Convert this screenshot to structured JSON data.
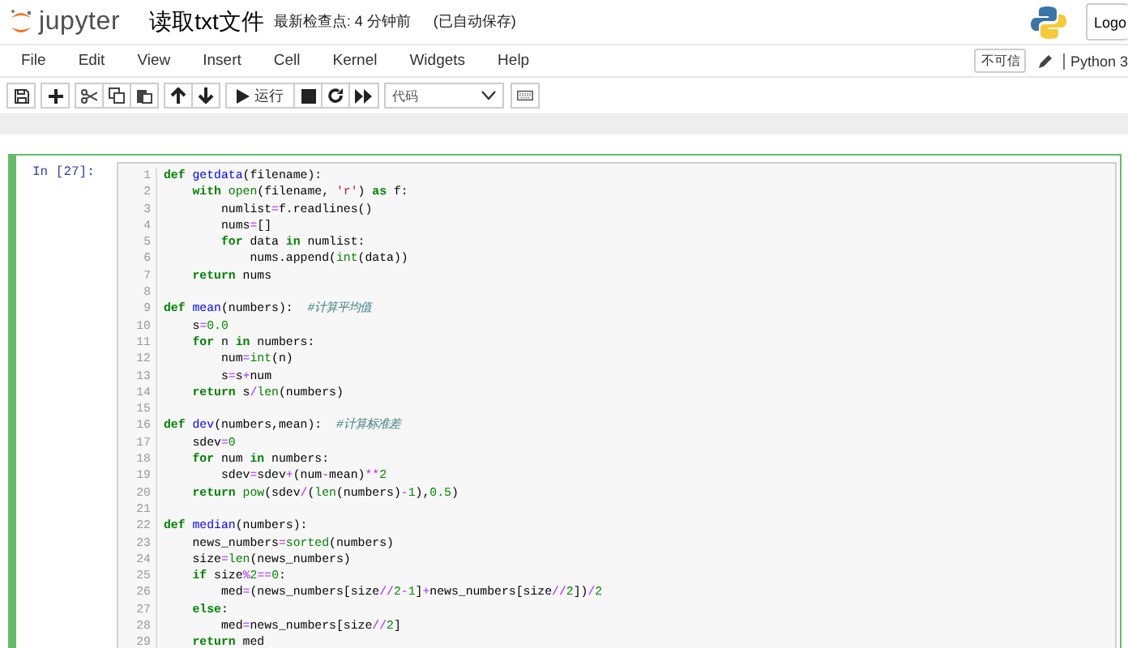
{
  "header": {
    "logo_text": "jupyter",
    "notebook_title": "读取txt文件",
    "checkpoint": "最新检查点: 4 分钟前",
    "autosave": "(已自动保存)",
    "logout_button": "Logo"
  },
  "menubar": {
    "items": [
      "File",
      "Edit",
      "View",
      "Insert",
      "Cell",
      "Kernel",
      "Widgets",
      "Help"
    ],
    "trust_badge": "不可信",
    "kernel_name": "Python 3"
  },
  "toolbar": {
    "run_button": "运行",
    "cell_type": "代码"
  },
  "cell": {
    "prompt": "In [27]:",
    "selected": true,
    "lines": [
      {
        "number": "1",
        "tokens": [
          {
            "kind": "kw",
            "text": "def"
          },
          {
            "kind": "fn",
            "text": " getdata"
          },
          {
            "kind": "p",
            "text": "(filename):"
          }
        ]
      },
      {
        "number": "2",
        "tokens": [
          {
            "kind": "kw",
            "text": "    with"
          },
          {
            "kind": "bi",
            "text": " open"
          },
          {
            "kind": "p",
            "text": "(filename,"
          },
          {
            "kind": "str",
            "text": " 'r'"
          },
          {
            "kind": "p",
            "text": ")"
          },
          {
            "kind": "kw",
            "text": " as"
          },
          {
            "kind": "p",
            "text": " f:"
          }
        ]
      },
      {
        "number": "3",
        "tokens": [
          {
            "kind": "p",
            "text": "        numlist"
          },
          {
            "kind": "op",
            "text": "="
          },
          {
            "kind": "p",
            "text": "f.readlines()"
          }
        ]
      },
      {
        "number": "4",
        "tokens": [
          {
            "kind": "p",
            "text": "        nums"
          },
          {
            "kind": "op",
            "text": "="
          },
          {
            "kind": "p",
            "text": "[]"
          }
        ]
      },
      {
        "number": "5",
        "tokens": [
          {
            "kind": "kw",
            "text": "        for"
          },
          {
            "kind": "p",
            "text": " data"
          },
          {
            "kind": "kw",
            "text": " in"
          },
          {
            "kind": "p",
            "text": " numlist:"
          }
        ]
      },
      {
        "number": "6",
        "tokens": [
          {
            "kind": "p",
            "text": "            nums.append("
          },
          {
            "kind": "bi",
            "text": "int"
          },
          {
            "kind": "p",
            "text": "(data))"
          }
        ]
      },
      {
        "number": "7",
        "tokens": [
          {
            "kind": "kw",
            "text": "    return"
          },
          {
            "kind": "p",
            "text": " nums"
          }
        ]
      },
      {
        "number": "8"
      },
      {
        "number": "9",
        "tokens": [
          {
            "kind": "kw",
            "text": "def"
          },
          {
            "kind": "fn",
            "text": " mean"
          },
          {
            "kind": "p",
            "text": "(numbers):"
          },
          {
            "kind": "cm",
            "text": "  #计算平均值"
          }
        ]
      },
      {
        "number": "10",
        "tokens": [
          {
            "kind": "p",
            "text": "    s"
          },
          {
            "kind": "op",
            "text": "="
          },
          {
            "kind": "num",
            "text": "0.0"
          }
        ]
      },
      {
        "number": "11",
        "tokens": [
          {
            "kind": "kw",
            "text": "    for"
          },
          {
            "kind": "p",
            "text": " n"
          },
          {
            "kind": "kw",
            "text": " in"
          },
          {
            "kind": "p",
            "text": " numbers:"
          }
        ]
      },
      {
        "number": "12",
        "tokens": [
          {
            "kind": "p",
            "text": "        num"
          },
          {
            "kind": "op",
            "text": "="
          },
          {
            "kind": "bi",
            "text": "int"
          },
          {
            "kind": "p",
            "text": "(n)"
          }
        ]
      },
      {
        "number": "13",
        "tokens": [
          {
            "kind": "p",
            "text": "        s"
          },
          {
            "kind": "op",
            "text": "="
          },
          {
            "kind": "p",
            "text": "s"
          },
          {
            "kind": "op",
            "text": "+"
          },
          {
            "kind": "p",
            "text": "num"
          }
        ]
      },
      {
        "number": "14",
        "tokens": [
          {
            "kind": "kw",
            "text": "    return"
          },
          {
            "kind": "p",
            "text": " s"
          },
          {
            "kind": "op",
            "text": "/"
          },
          {
            "kind": "bi",
            "text": "len"
          },
          {
            "kind": "p",
            "text": "(numbers)"
          }
        ]
      },
      {
        "number": "15"
      },
      {
        "number": "16",
        "tokens": [
          {
            "kind": "kw",
            "text": "def"
          },
          {
            "kind": "fn",
            "text": " dev"
          },
          {
            "kind": "p",
            "text": "(numbers,mean):"
          },
          {
            "kind": "cm",
            "text": "  #计算标准差"
          }
        ]
      },
      {
        "number": "17",
        "tokens": [
          {
            "kind": "p",
            "text": "    sdev"
          },
          {
            "kind": "op",
            "text": "="
          },
          {
            "kind": "num",
            "text": "0"
          }
        ]
      },
      {
        "number": "18",
        "tokens": [
          {
            "kind": "kw",
            "text": "    for"
          },
          {
            "kind": "p",
            "text": " num"
          },
          {
            "kind": "kw",
            "text": " in"
          },
          {
            "kind": "p",
            "text": " numbers:"
          }
        ]
      },
      {
        "number": "19",
        "tokens": [
          {
            "kind": "p",
            "text": "        sdev"
          },
          {
            "kind": "op",
            "text": "="
          },
          {
            "kind": "p",
            "text": "sdev"
          },
          {
            "kind": "op",
            "text": "+"
          },
          {
            "kind": "p",
            "text": "(num"
          },
          {
            "kind": "op",
            "text": "-"
          },
          {
            "kind": "p",
            "text": "mean)"
          },
          {
            "kind": "op",
            "text": "**"
          },
          {
            "kind": "num",
            "text": "2"
          }
        ]
      },
      {
        "number": "20",
        "tokens": [
          {
            "kind": "kw",
            "text": "    return"
          },
          {
            "kind": "bi",
            "text": " pow"
          },
          {
            "kind": "p",
            "text": "(sdev"
          },
          {
            "kind": "op",
            "text": "/"
          },
          {
            "kind": "p",
            "text": "("
          },
          {
            "kind": "bi",
            "text": "len"
          },
          {
            "kind": "p",
            "text": "(numbers)"
          },
          {
            "kind": "op",
            "text": "-"
          },
          {
            "kind": "num",
            "text": "1"
          },
          {
            "kind": "p",
            "text": "),"
          },
          {
            "kind": "num",
            "text": "0.5"
          },
          {
            "kind": "p",
            "text": ")"
          }
        ]
      },
      {
        "number": "21"
      },
      {
        "number": "22",
        "tokens": [
          {
            "kind": "kw",
            "text": "def"
          },
          {
            "kind": "fn",
            "text": " median"
          },
          {
            "kind": "p",
            "text": "(numbers):"
          }
        ]
      },
      {
        "number": "23",
        "tokens": [
          {
            "kind": "p",
            "text": "    news_numbers"
          },
          {
            "kind": "op",
            "text": "="
          },
          {
            "kind": "bi",
            "text": "sorted"
          },
          {
            "kind": "p",
            "text": "(numbers)"
          }
        ]
      },
      {
        "number": "24",
        "tokens": [
          {
            "kind": "p",
            "text": "    size"
          },
          {
            "kind": "op",
            "text": "="
          },
          {
            "kind": "bi",
            "text": "len"
          },
          {
            "kind": "p",
            "text": "(news_numbers)"
          }
        ]
      },
      {
        "number": "25",
        "tokens": [
          {
            "kind": "kw",
            "text": "    if"
          },
          {
            "kind": "p",
            "text": " size"
          },
          {
            "kind": "op",
            "text": "%"
          },
          {
            "kind": "num",
            "text": "2"
          },
          {
            "kind": "op",
            "text": "=="
          },
          {
            "kind": "num",
            "text": "0"
          },
          {
            "kind": "p",
            "text": ":"
          }
        ]
      },
      {
        "number": "26",
        "tokens": [
          {
            "kind": "p",
            "text": "        med"
          },
          {
            "kind": "op",
            "text": "="
          },
          {
            "kind": "p",
            "text": "(news_numbers[size"
          },
          {
            "kind": "op",
            "text": "//"
          },
          {
            "kind": "num",
            "text": "2"
          },
          {
            "kind": "op",
            "text": "-"
          },
          {
            "kind": "num",
            "text": "1"
          },
          {
            "kind": "p",
            "text": "]"
          },
          {
            "kind": "op",
            "text": "+"
          },
          {
            "kind": "p",
            "text": "news_numbers[size"
          },
          {
            "kind": "op",
            "text": "//"
          },
          {
            "kind": "num",
            "text": "2"
          },
          {
            "kind": "p",
            "text": "])"
          },
          {
            "kind": "op",
            "text": "/"
          },
          {
            "kind": "num",
            "text": "2"
          }
        ]
      },
      {
        "number": "27",
        "tokens": [
          {
            "kind": "kw",
            "text": "    else"
          },
          {
            "kind": "p",
            "text": ":"
          }
        ]
      },
      {
        "number": "28",
        "tokens": [
          {
            "kind": "p",
            "text": "        med"
          },
          {
            "kind": "op",
            "text": "="
          },
          {
            "kind": "p",
            "text": "news_numbers[size"
          },
          {
            "kind": "op",
            "text": "//"
          },
          {
            "kind": "num",
            "text": "2"
          },
          {
            "kind": "p",
            "text": "]"
          }
        ]
      },
      {
        "number": "29",
        "tokens": [
          {
            "kind": "kw",
            "text": "    return"
          },
          {
            "kind": "p",
            "text": " med"
          }
        ]
      }
    ]
  }
}
